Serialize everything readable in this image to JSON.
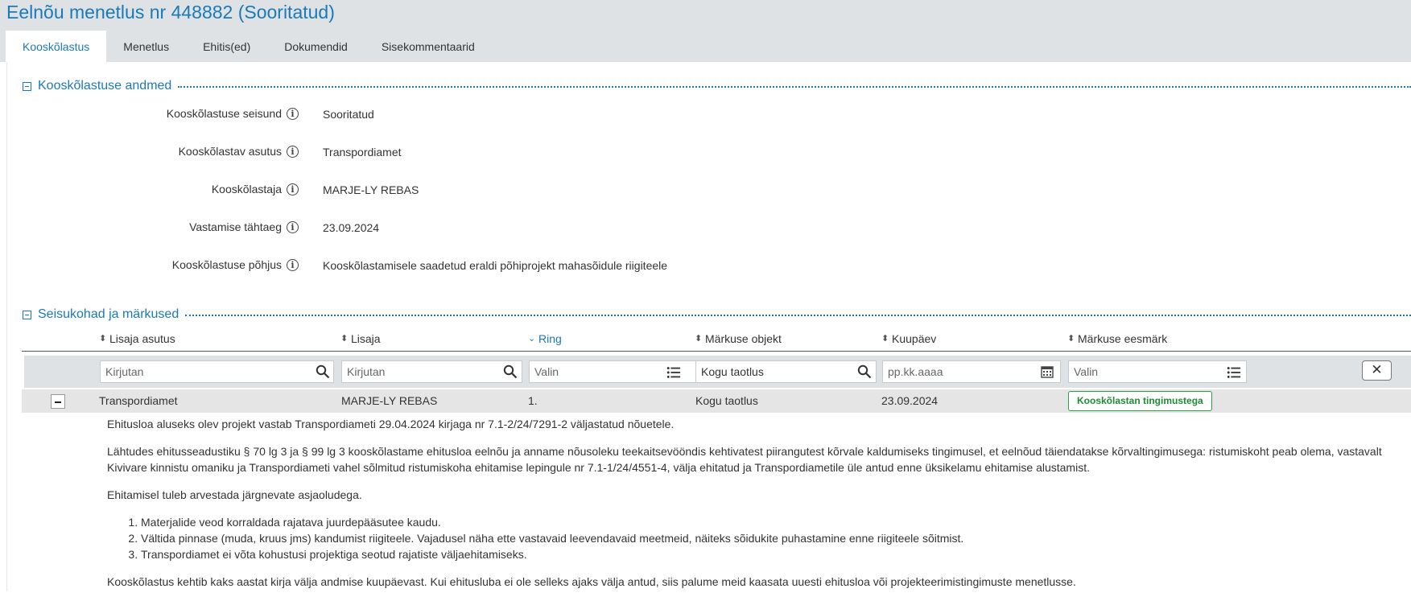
{
  "page": {
    "title": "Eelnõu menetlus nr 448882 (Sooritatud)"
  },
  "tabs": [
    {
      "label": "Kooskõlastus",
      "active": true
    },
    {
      "label": "Menetlus",
      "active": false
    },
    {
      "label": "Ehitis(ed)",
      "active": false
    },
    {
      "label": "Dokumendid",
      "active": false
    },
    {
      "label": "Sisekommentaarid",
      "active": false
    }
  ],
  "section1": {
    "title": "Kooskõlastuse andmed",
    "fields": [
      {
        "label": "Kooskõlastuse seisund",
        "value": "Sooritatud"
      },
      {
        "label": "Kooskõlastav asutus",
        "value": "Transpordiamet"
      },
      {
        "label": "Kooskõlastaja",
        "value": "MARJE-LY REBAS"
      },
      {
        "label": "Vastamise tähtaeg",
        "value": "23.09.2024"
      },
      {
        "label": "Kooskõlastuse põhjus",
        "value": "Kooskõlastamisele saadetud eraldi põhiprojekt mahasõidule riigiteele"
      }
    ]
  },
  "section2": {
    "title": "Seisukohad ja märkused",
    "columns": [
      {
        "label": "Lisaja asutus",
        "sorted": false
      },
      {
        "label": "Lisaja",
        "sorted": false
      },
      {
        "label": "Ring",
        "sorted": true
      },
      {
        "label": "Märkuse objekt",
        "sorted": false
      },
      {
        "label": "Kuupäev",
        "sorted": false
      },
      {
        "label": "Märkuse eesmärk",
        "sorted": false
      }
    ],
    "filters": {
      "lisaja_asutus": {
        "value": "",
        "placeholder": "Kirjutan"
      },
      "lisaja": {
        "value": "",
        "placeholder": "Kirjutan"
      },
      "ring": {
        "value": "",
        "placeholder": "Valin"
      },
      "markuse_objekt": {
        "value": "Kogu taotlus",
        "placeholder": ""
      },
      "kuupaev": {
        "value": "",
        "placeholder": "pp.kk.aaaa"
      },
      "markuse_eesmark": {
        "value": "",
        "placeholder": "Valin"
      }
    },
    "row": {
      "lisaja_asutus": "Transpordiamet",
      "lisaja": "MARJE-LY REBAS",
      "ring": "1.",
      "markuse_objekt": "Kogu taotlus",
      "kuupaev": "23.09.2024",
      "markuse_eesmark": "Kooskõlastan tingimustega"
    },
    "comment": {
      "p1": "Ehitusloa aluseks olev projekt vastab Transpordiameti 29.04.2024 kirjaga nr 7.1-2/24/7291-2 väljastatud nõuetele.",
      "p2_line1": "Lähtudes ehitusseadustiku § 70 lg 3 ja § 99 lg 3 kooskõlastame ehitusloa eelnõu ja anname nõusoleku teekaitsevööndis kehtivatest piirangutest kõrvale kaldumiseks tingimusel, et eelnõud täiendatakse kõrvaltingimusega: ristumiskoht peab olema, vastavalt",
      "p2_line2": "Kivivare kinnistu omaniku ja Transpordiameti vahel sõlmitud ristumiskoha ehitamise lepingule nr 7.1-1/24/4551-4, välja ehitatud ja Transpordiametile üle antud enne üksikelamu ehitamise alustamist.",
      "p3": "Ehitamisel tuleb arvestada järgnevate asjaoludega.",
      "list": [
        "Materjalide veod korraldada rajatava juurdepääsutee kaudu.",
        "Vältida pinnase (muda, kruus jms) kandumist riigiteele. Vajadusel näha ette vastavaid leevendavaid meetmeid, näiteks sõidukite puhastamine enne riigiteele sõitmist.",
        "Transpordiamet ei võta kohustusi projektiga seotud rajatiste väljaehitamiseks."
      ],
      "p4": "Kooskõlastus kehtib kaks aastat kirja välja andmise kuupäevast. Kui ehitusluba ei ole selleks ajaks välja antud, siis palume meid kaasata uuesti ehitusloa või projekteerimistingimuste menetlusse."
    }
  }
}
